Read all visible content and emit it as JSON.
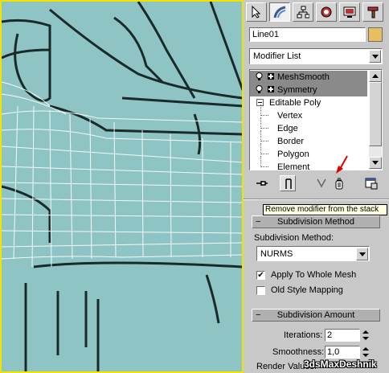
{
  "panel": {
    "tabs": [
      {
        "name": "create-tab",
        "icon": "cursor-arrow-icon"
      },
      {
        "name": "modify-tab",
        "icon": "modify-arc-icon"
      },
      {
        "name": "hierarchy-tab",
        "icon": "hierarchy-icon"
      },
      {
        "name": "motion-tab",
        "icon": "motion-circle-icon"
      },
      {
        "name": "display-tab",
        "icon": "display-monitor-icon"
      },
      {
        "name": "utilities-tab",
        "icon": "hammer-icon"
      }
    ],
    "object_name": "Line01",
    "object_color": "#e6c060",
    "modifier_list_label": "Modifier List",
    "stack": {
      "modifiers": [
        "MeshSmooth",
        "Symmetry"
      ],
      "base": "Editable Poly",
      "subobjects": [
        "Vertex",
        "Edge",
        "Border",
        "Polygon",
        "Element"
      ]
    },
    "tooltip": "Remove modifier from the stack",
    "subdivision_method": {
      "rollout_title": "Subdivision Method",
      "label": "Subdivision Method:",
      "selected": "NURMS",
      "apply_to_whole_mesh_label": "Apply To Whole Mesh",
      "apply_to_whole_mesh": true,
      "old_style_mapping_label": "Old Style Mapping",
      "old_style_mapping": false
    },
    "subdivision_amount": {
      "rollout_title": "Subdivision Amount",
      "iterations_label": "Iterations:",
      "iterations": "2",
      "smoothness_label": "Smoothness:",
      "smoothness": "1,0",
      "render_values_label": "Render Values:"
    },
    "rollout_toggle": "−"
  },
  "watermark": "3dsMaxDeshnik"
}
